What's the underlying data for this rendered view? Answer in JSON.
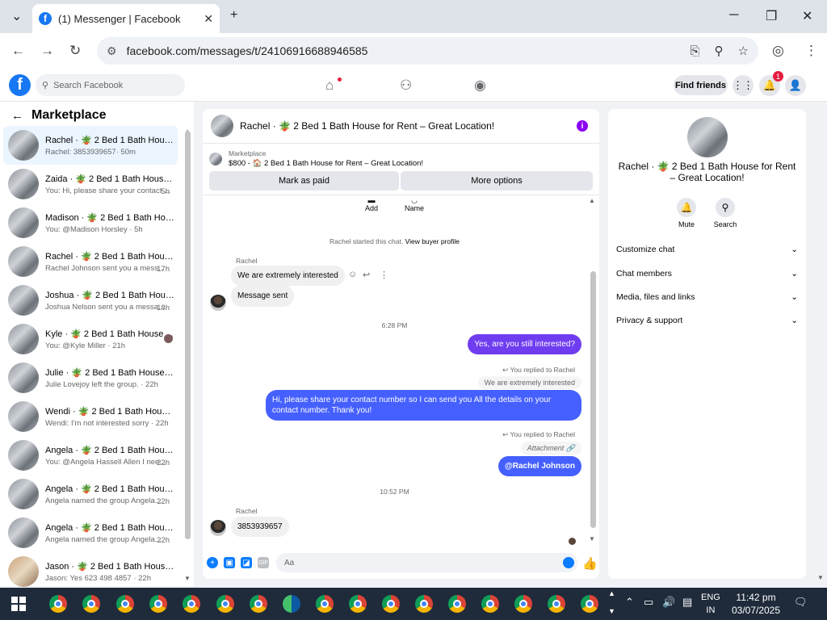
{
  "browser": {
    "tab_title": "(1) Messenger | Facebook",
    "url": "facebook.com/messages/t/24106916688946585"
  },
  "fb": {
    "search_placeholder": "Search Facebook",
    "find_friends": "Find friends",
    "notification_count": "1"
  },
  "left": {
    "title": "Marketplace",
    "conversations": [
      {
        "name": "Rachel · 🪴 2 Bed 1 Bath House...",
        "preview": "Rachel: 3853939657",
        "time": "· 50m"
      },
      {
        "name": "Zaida · 🪴 2 Bed 1 Bath House f...",
        "preview": "You: Hi, please share your contact ...",
        "time": "5h"
      },
      {
        "name": "Madison · 🪴 2 Bed 1 Bath Hou...",
        "preview": "You: @Madison Horsley · 5h",
        "time": ""
      },
      {
        "name": "Rachel · 🪴 2 Bed 1 Bath House...",
        "preview": "Rachel Johnson sent you a mess...",
        "time": "17h"
      },
      {
        "name": "Joshua · 🪴 2 Bed 1 Bath House...",
        "preview": "Joshua Nelson sent you a messa...",
        "time": "18h"
      },
      {
        "name": "Kyle · 🪴 2 Bed 1 Bath House ...",
        "preview": "You: @Kyle Miller · 21h",
        "time": ""
      },
      {
        "name": "Julie · 🪴 2 Bed 1 Bath House f...",
        "preview": "Julie Lovejoy left the group. · 22h",
        "time": ""
      },
      {
        "name": "Wendi · 🪴 2 Bed 1 Bath House ...",
        "preview": "Wendi: I'm not interested sorry · 22h",
        "time": ""
      },
      {
        "name": "Angela · 🪴 2 Bed 1 Bath House...",
        "preview": "You: @Angela Hassell Allen I nee...",
        "time": "22h"
      },
      {
        "name": "Angela · 🪴 2 Bed 1 Bath House...",
        "preview": "Angela named the group Angela...",
        "time": "22h"
      },
      {
        "name": "Angela · 🪴 2 Bed 1 Bath House...",
        "preview": "Angela named the group Angela...",
        "time": "22h"
      },
      {
        "name": "Jason · 🪴 2 Bed 1 Bath House f...",
        "preview": "Jason: Yes 623 498 4857 · 22h",
        "time": ""
      }
    ]
  },
  "chat": {
    "title": "Rachel · 🪴 2 Bed 1 Bath House for Rent – Great Location!",
    "marketplace_label": "Marketplace",
    "listing": "$800 - 🏠 2 Bed 1 Bath House for Rent – Great Location!",
    "mark_paid": "Mark as paid",
    "more_options": "More options",
    "add_label": "Add",
    "name_label": "Name",
    "started": "Rachel started this chat.",
    "view_profile": "View buyer profile",
    "sender": "Rachel",
    "msg1": "We are extremely interested",
    "msg2": "Message sent",
    "time1": "6:28 PM",
    "out1": "Yes, are you still interested?",
    "replied": "You replied to Rachel",
    "quote1": "We are extremely interested",
    "out2": "Hi, please share your contact number so I can send you All the details on your contact number. Thank you!",
    "replied2": "You replied to Rachel",
    "attachment": "Attachment",
    "out3": "@Rachel Johnson",
    "time2": "10:52 PM",
    "sender2": "Rachel",
    "msg3": "3853939657",
    "input_placeholder": "Aa"
  },
  "right": {
    "title": "Rachel · 🪴 2 Bed 1 Bath House for Rent – Great Location!",
    "mute": "Mute",
    "search": "Search",
    "sections": [
      "Customize chat",
      "Chat members",
      "Media, files and links",
      "Privacy & support"
    ]
  },
  "taskbar": {
    "lang1": "ENG",
    "lang2": "IN",
    "time": "11:42 pm",
    "date": "03/07/2025"
  }
}
